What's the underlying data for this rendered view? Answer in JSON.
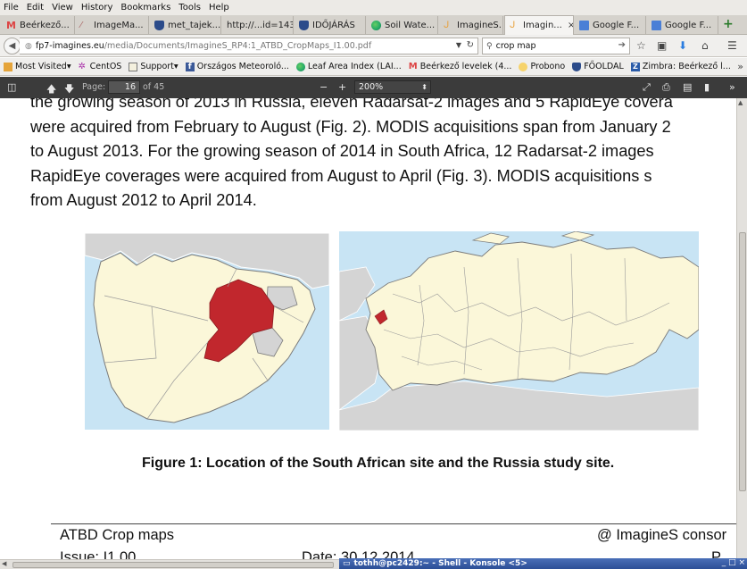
{
  "menu": {
    "file": "File",
    "edit": "Edit",
    "view": "View",
    "history": "History",
    "bookmarks": "Bookmarks",
    "tools": "Tools",
    "help": "Help"
  },
  "tabs": [
    {
      "label": "Beérkező...",
      "icon": "gmail-icon"
    },
    {
      "label": "ImageMa...",
      "icon": "image-icon"
    },
    {
      "label": "met_tajek...",
      "icon": "shield-icon"
    },
    {
      "label": "http://...id=143",
      "icon": ""
    },
    {
      "label": "IDŐJÁRÁS",
      "icon": "shield-icon"
    },
    {
      "label": "Soil Wate...",
      "icon": "globe-icon"
    },
    {
      "label": "ImagineS...",
      "icon": "page-icon"
    },
    {
      "label": "Imagin...",
      "icon": "page-icon"
    },
    {
      "label": "Google F...",
      "icon": "google-forms-icon"
    },
    {
      "label": "Google F...",
      "icon": "google-forms-icon"
    }
  ],
  "active_tab_close": "×",
  "new_tab": "+",
  "url": {
    "host": "fp7-imagines.eu",
    "path": "/media/Documents/ImagineS_RP4:1_ATBD_CropMaps_I1.00.pdf"
  },
  "search": {
    "value": "crop map"
  },
  "bookmarks": [
    {
      "label": "Most Visited",
      "caret": "▾",
      "icon": "bookmark-folder-icon"
    },
    {
      "label": "CentOS",
      "caret": "",
      "icon": "centos-icon"
    },
    {
      "label": "Support",
      "caret": "▾",
      "icon": "folder-icon"
    },
    {
      "label": "Országos Meteoroló...",
      "caret": "",
      "icon": "facebook-icon"
    },
    {
      "label": "Leaf Area Index (LAI...",
      "caret": "",
      "icon": "globe-icon"
    },
    {
      "label": "Beérkező levelek (4...",
      "caret": "",
      "icon": "gmail-icon"
    },
    {
      "label": "Probono",
      "caret": "",
      "icon": "sun-icon"
    },
    {
      "label": "FŐOLDAL",
      "caret": "",
      "icon": "shield-icon"
    },
    {
      "label": "Zimbra: Beérkező l...",
      "caret": "",
      "icon": "zimbra-icon"
    }
  ],
  "bookmarks_more": "»",
  "pdf_toolbar": {
    "page_label": "Page:",
    "page_value": "16",
    "page_total": "of 45",
    "zoom_out": "−",
    "zoom_in": "+",
    "zoom": "200%"
  },
  "document": {
    "lines": [
      "the growing season of 2013 in Russia, eleven Radarsat-2 images and 5 RapidEye covera",
      "were acquired from February to August (Fig. 2). MODIS acquisitions span from January 2",
      "to August 2013. For the growing season of 2014 in South Africa, 12 Radarsat-2 images",
      "RapidEye coverages were acquired from August to April (Fig. 3). MODIS acquisitions s",
      "from August 2012 to April 2014."
    ],
    "caption": "Figure 1: Location of the South African site and the Russia study site.",
    "footer_left": "ATBD Crop maps",
    "footer_right": "@ ImagineS consor",
    "footer_issue": "Issue: I1.00",
    "footer_date": "Date: 30.12.2014",
    "footer_page": "P"
  },
  "colors": {
    "highlight_region": "#c1272d",
    "land": "#fbf7d9",
    "water": "#c8e4f4",
    "other_land": "#d4d4d4"
  },
  "taskbar": {
    "konsole_title": "tothh@pc2429:~ - Shell - Konsole <5>",
    "konsole_controls": "_ □ ×"
  }
}
